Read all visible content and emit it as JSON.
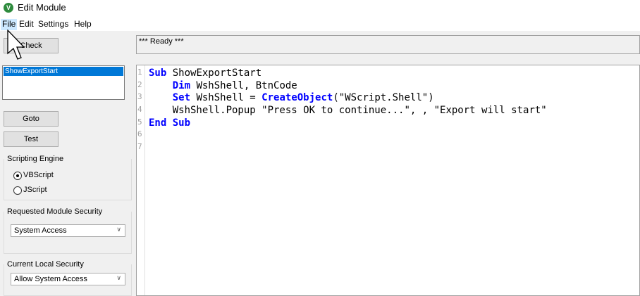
{
  "window": {
    "title": "Edit Module",
    "icon_letter": "V"
  },
  "menu": {
    "file": "File",
    "edit": "Edit",
    "settings": "Settings",
    "help": "Help"
  },
  "buttons": {
    "check": "Check",
    "goto": "Goto",
    "test": "Test"
  },
  "module_list": {
    "items": [
      "ShowExportStart"
    ]
  },
  "engine": {
    "label": "Scripting Engine",
    "vbscript": "VBScript",
    "jscript": "JScript",
    "selected": "VBScript"
  },
  "requested_security": {
    "label": "Requested Module Security",
    "value": "System Access"
  },
  "local_security": {
    "label": "Current Local Security",
    "value": "Allow System Access"
  },
  "status": {
    "text": "*** Ready ***"
  },
  "editor": {
    "line_numbers": [
      "1",
      "2",
      "3",
      "4",
      "5",
      "6",
      "7"
    ],
    "lines": [
      {
        "kw1": "Sub",
        "rest": " ShowExportStart"
      },
      {
        "indent": "    ",
        "kw1": "Dim",
        "rest": " WshShell, BtnCode"
      },
      {
        "indent": "    ",
        "kw1": "Set",
        "mid": " WshShell = ",
        "fn": "CreateObject",
        "rest": "(\"WScript.Shell\")"
      },
      {
        "indent": "    ",
        "rest": "WshShell.Popup \"Press OK to continue...\", , \"Export will start\""
      },
      {
        "kw1": "End",
        "kw2": " Sub"
      }
    ]
  }
}
